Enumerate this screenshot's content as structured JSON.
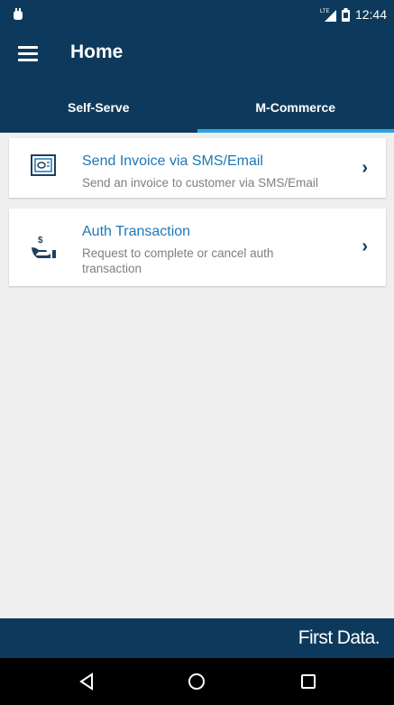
{
  "status_bar": {
    "time": "12:44",
    "network": "LTE"
  },
  "app_bar": {
    "title": "Home"
  },
  "tabs": [
    {
      "label": "Self-Serve",
      "active": false
    },
    {
      "label": "M-Commerce",
      "active": true
    }
  ],
  "cards": [
    {
      "title": "Send Invoice via SMS/Email",
      "subtitle": "Send an invoice to customer via SMS/Email",
      "icon": "invoice-icon"
    },
    {
      "title": "Auth Transaction",
      "subtitle": "Request to complete or cancel auth transaction",
      "icon": "hand-money-icon"
    }
  ],
  "footer": {
    "brand": "First Data."
  },
  "colors": {
    "primary": "#0d3a5c",
    "accent": "#2da2e0",
    "link": "#1d78b8",
    "background": "#efefef"
  }
}
